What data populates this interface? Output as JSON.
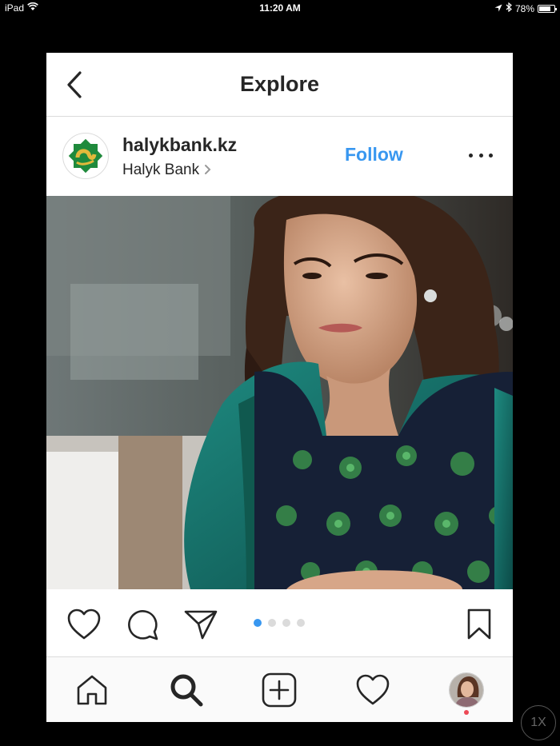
{
  "status_bar": {
    "device": "iPad",
    "time": "11:20 AM",
    "battery": "78%",
    "battery_level": 0.78,
    "icons": [
      "wifi-icon",
      "location-arrow-icon",
      "bluetooth-icon",
      "battery-icon"
    ]
  },
  "nav": {
    "title": "Explore",
    "back_icon": "chevron-left-icon"
  },
  "post": {
    "username": "halykbank.kz",
    "location": "Halyk Bank",
    "follow_label": "Follow",
    "more_icon": "ellipsis-icon",
    "image_description_icon": "photo-icon",
    "carousel": {
      "count": 4,
      "active_index": 0
    }
  },
  "actions": {
    "icons": [
      "heart-icon",
      "comment-icon",
      "share-icon",
      "bookmark-icon"
    ]
  },
  "tabbar": {
    "icons": [
      "home-icon",
      "search-icon",
      "add-post-icon",
      "activity-heart-icon",
      "profile-avatar"
    ]
  },
  "zoom": {
    "label": "1X"
  },
  "colors": {
    "accent": "#3897f0",
    "text": "#262626",
    "divider": "#dbdbdb",
    "notification": "#ed4956"
  }
}
